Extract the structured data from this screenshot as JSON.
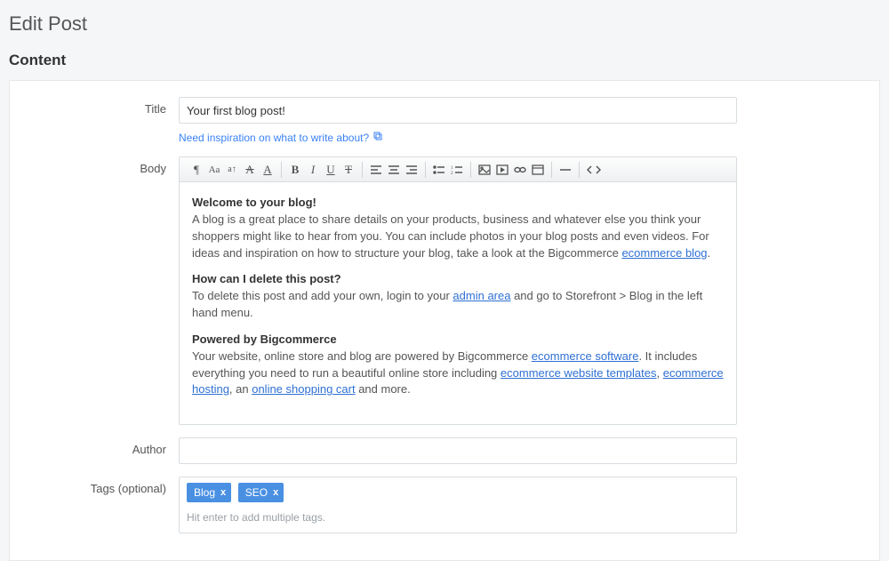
{
  "page": {
    "title": "Edit Post"
  },
  "section": {
    "content": "Content"
  },
  "labels": {
    "title": "Title",
    "body": "Body",
    "author": "Author",
    "tags": "Tags (optional)"
  },
  "fields": {
    "title_value": "Your first blog post!",
    "helper_link": "Need inspiration on what to write about?",
    "author_value": "",
    "tags_placeholder": "Hit enter to add multiple tags."
  },
  "tags": {
    "items": [
      {
        "label": "Blog"
      },
      {
        "label": "SEO"
      }
    ]
  },
  "body": {
    "h1": "Welcome to your blog!",
    "p1_a": "A blog is a great place to share details on your products, business and whatever else you think your shoppers might like to hear from you. You can include photos in your blog posts and even videos. For ideas and inspiration on how to structure your blog, take a look at the Bigcommerce ",
    "p1_link": "ecommerce blog",
    "p1_b": ".",
    "h2": "How can I delete this post?",
    "p2_a": "To delete this post and add your own, login to your ",
    "p2_link": "admin area",
    "p2_b": " and go to Storefront > Blog in the left hand menu.",
    "h3": "Powered by Bigcommerce",
    "p3_a": "Your website, online store and blog are powered by Bigcommerce ",
    "p3_link1": "ecommerce software",
    "p3_b": ". It includes everything you need to run a beautiful online store including ",
    "p3_link2": "ecommerce website templates",
    "p3_c": ", ",
    "p3_link3": "ecommerce hosting",
    "p3_d": ", an ",
    "p3_link4": "online shopping cart",
    "p3_e": " and more."
  },
  "toolbar": {
    "para": "¶",
    "fontfamily": "Aa",
    "fontsize": "a↑",
    "clear": "A",
    "underlineA": "A",
    "bold": "B",
    "italic": "I",
    "underline": "U",
    "strike": "T"
  }
}
